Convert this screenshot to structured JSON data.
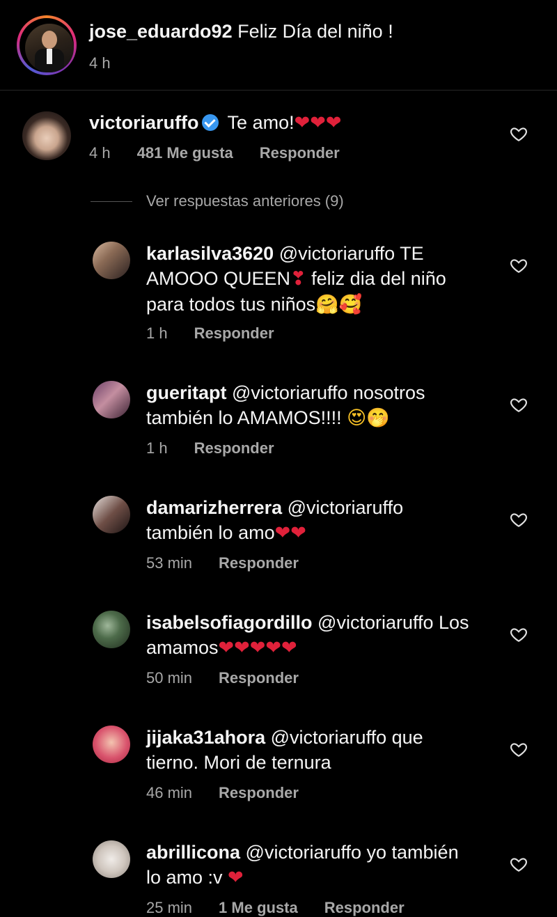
{
  "post": {
    "username": "jose_eduardo92",
    "caption": " Feliz Día del niño !",
    "time": "4 h"
  },
  "top_comment": {
    "username": "victoriaruffo",
    "text": "Te amo!",
    "emoji": "❤❤❤",
    "time": "4 h",
    "likes": "481 Me gusta",
    "reply": "Responder"
  },
  "view_replies": "Ver respuestas anteriores (9)",
  "replies": [
    {
      "username": "karlasilva3620",
      "line1": " @victoriaruffo TE",
      "line2": "AMOOO QUEEN",
      "line2_emoji": "❣",
      "line2_rest": " feliz dia del niño",
      "line3": "para todos tus niños",
      "line3_emoji": "🤗🥰",
      "time": "1 h",
      "reply": "Responder"
    },
    {
      "username": "gueritapt",
      "line1": " @victoriaruffo nosotros",
      "line2": "también lo AMAMOS!!!! ",
      "line2_emoji": "😍🤭",
      "time": "1 h",
      "reply": "Responder"
    },
    {
      "username": "damarizherrera",
      "line1": " @victoriaruffo",
      "line2": "también lo amo",
      "line2_emoji": "❤❤",
      "time": "53 min",
      "reply": "Responder"
    },
    {
      "username": "isabelsofiagordillo",
      "line1": " @victoriaruffo Los",
      "line2": "amamos",
      "line2_emoji": "❤❤❤❤❤",
      "time": "50 min",
      "reply": "Responder"
    },
    {
      "username": "jijaka31ahora",
      "line1": " @victoriaruffo que",
      "line2": "tierno. Mori de ternura",
      "time": "46 min",
      "reply": "Responder"
    },
    {
      "username": "abrillicona",
      "line1": " @victoriaruffo yo también",
      "line2": "lo amo :v ",
      "line2_emoji": "❤",
      "time": "25 min",
      "likes": "1 Me gusta",
      "reply": "Responder"
    }
  ],
  "icons": {
    "like": "heart-outline-icon",
    "verified": "verified-badge-icon"
  },
  "colors": {
    "background": "#000000",
    "text": "#f5f5f5",
    "meta": "#a8a8a8",
    "heart": "#e0213a",
    "verified": "#3897f0"
  }
}
